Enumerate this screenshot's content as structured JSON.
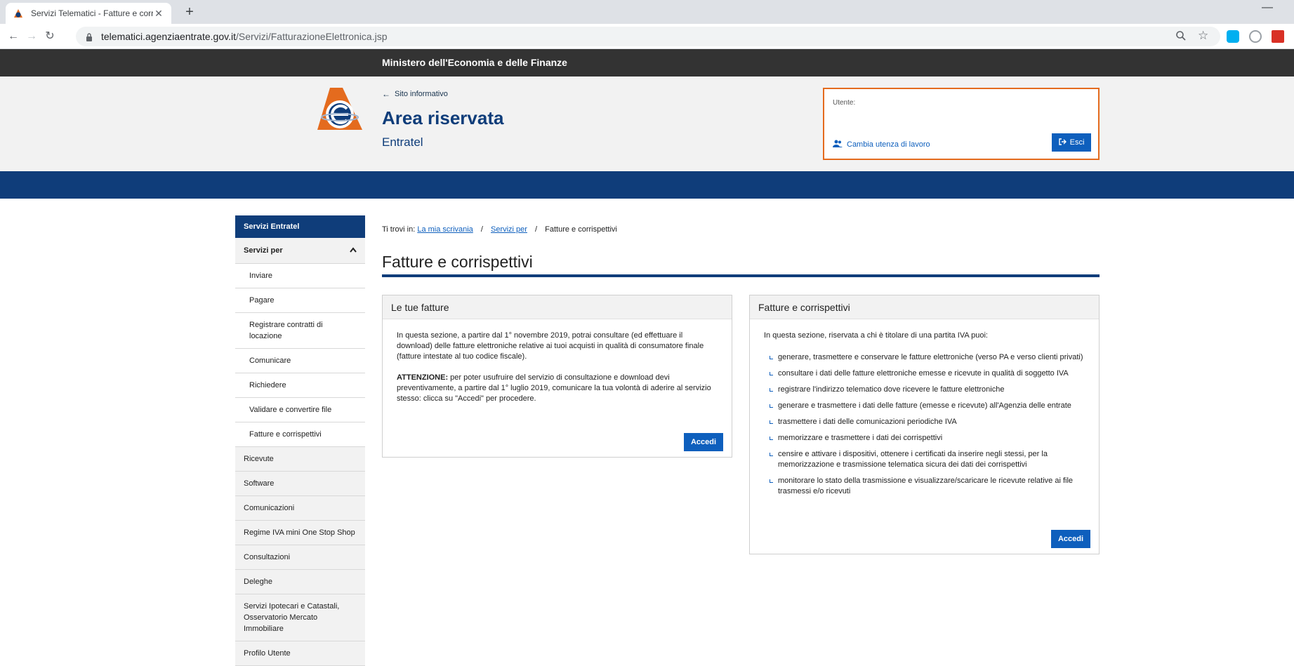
{
  "browser": {
    "tab_title": "Servizi Telematici - Fatture e corr",
    "url_host": "telematici.agenziaentrate.gov.it",
    "url_path": "/Servizi/FatturazioneElettronica.jsp"
  },
  "ministry": "Ministero dell'Economia e delle Finanze",
  "header": {
    "back_link": "Sito informativo",
    "title": "Area riservata",
    "subtitle": "Entratel"
  },
  "user": {
    "label": "Utente:",
    "change_link": "Cambia utenza di lavoro",
    "exit_button": "Esci"
  },
  "sidebar": {
    "heading": "Servizi Entratel",
    "open_section": "Servizi per",
    "subitems": [
      "Inviare",
      "Pagare",
      "Registrare contratti di locazione",
      "Comunicare",
      "Richiedere",
      "Validare e convertire file",
      "Fatture e corrispettivi"
    ],
    "items": [
      "Ricevute",
      "Software",
      "Comunicazioni",
      "Regime IVA mini One Stop Shop",
      "Consultazioni",
      "Deleghe",
      "Servizi Ipotecari e Catastali, Osservatorio Mercato Immobiliare",
      "Profilo Utente"
    ]
  },
  "breadcrumb": {
    "prefix": "Ti trovi in:",
    "link1": "La mia scrivania",
    "link2": "Servizi per",
    "current": "Fatture e corrispettivi"
  },
  "page_title": "Fatture e corrispettivi",
  "card_left": {
    "title": "Le tue fatture",
    "para1": "In questa sezione, a partire dal 1° novembre 2019, potrai consultare (ed effettuare il download) delle fatture elettroniche relative ai tuoi acquisti in qualità di consumatore finale (fatture intestate al tuo codice fiscale).",
    "attention_label": "ATTENZIONE:",
    "para2": " per poter usufruire del servizio di consultazione e download devi preventivamente, a partire dal 1° luglio 2019, comunicare la tua volontà di aderire al servizio stesso: clicca su \"Accedi\" per procedere.",
    "button": "Accedi"
  },
  "card_right": {
    "title": "Fatture e corrispettivi",
    "intro": "In questa sezione, riservata a chi è titolare di una partita IVA puoi:",
    "items": [
      "generare, trasmettere e conservare le fatture elettroniche (verso PA e verso clienti privati)",
      "consultare i dati delle fatture elettroniche emesse e ricevute in qualità di soggetto IVA",
      "registrare l'indirizzo telematico dove ricevere le fatture elettroniche",
      "generare e trasmettere i dati delle fatture (emesse e ricevute) all'Agenzia delle entrate",
      "trasmettere i dati delle comunicazioni periodiche IVA",
      "memorizzare e trasmettere i dati dei corrispettivi",
      "censire e attivare i dispositivi, ottenere i certificati da inserire negli stessi, per la memorizzazione e trasmissione telematica sicura dei dati dei corrispettivi",
      "monitorare lo stato della trasmissione e visualizzare/scaricare le ricevute relative ai file trasmessi e/o ricevuti"
    ],
    "button": "Accedi"
  }
}
